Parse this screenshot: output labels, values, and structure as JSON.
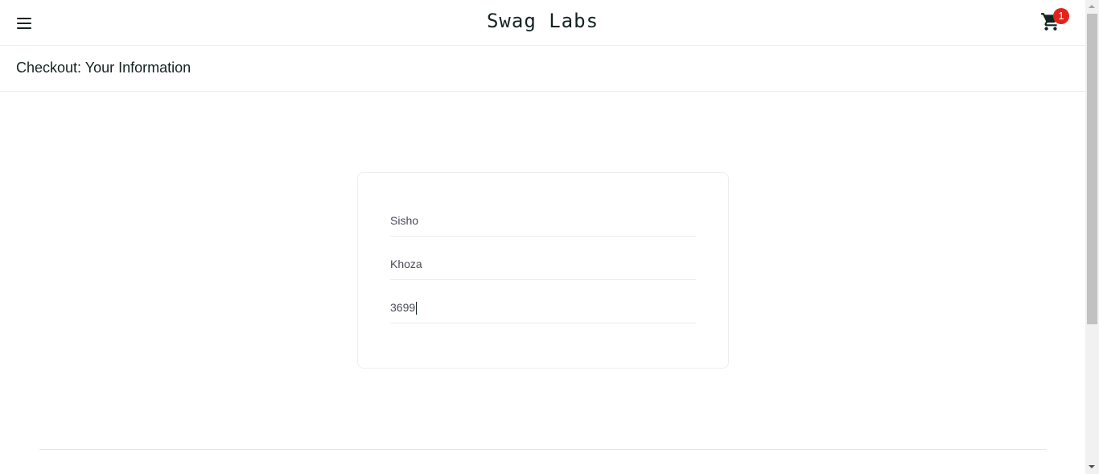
{
  "header": {
    "logo": "Swag Labs",
    "cart_count": "1",
    "menu_icon": "hamburger-menu-icon",
    "cart_icon": "shopping-cart-icon"
  },
  "secondary_header": {
    "title": "Checkout: Your Information"
  },
  "form": {
    "first_name": {
      "value": "Sisho"
    },
    "last_name": {
      "value": "Khoza"
    },
    "postal_code": {
      "value": "3699"
    }
  },
  "colors": {
    "text": "#132322",
    "badge": "#e2231a",
    "border": "#ededed"
  }
}
